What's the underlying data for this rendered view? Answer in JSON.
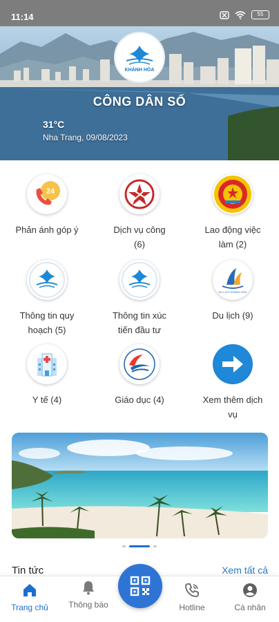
{
  "status_bar": {
    "time": "11:14",
    "battery": "55"
  },
  "hero": {
    "logo_text": "KHÁNH HÒA",
    "title": "CÔNG DÂN SỐ",
    "temperature": "31°C",
    "location_date": "Nha Trang, 09/08/2023"
  },
  "services": [
    {
      "line1": "Phản ánh góp ý",
      "line2": ""
    },
    {
      "line1": "Dịch vụ công",
      "line2": "(6)"
    },
    {
      "line1": "Lao động việc",
      "line2": "làm (2)"
    },
    {
      "line1": "Thông tin quy",
      "line2": "hoạch (5)"
    },
    {
      "line1": "Thông tin xúc",
      "line2": "tiến đầu tư"
    },
    {
      "line1": "Du lịch (9)",
      "line2": ""
    },
    {
      "line1": "Y tế (4)",
      "line2": ""
    },
    {
      "line1": "Giáo dục (4)",
      "line2": ""
    },
    {
      "line1": "Xem thêm dịch",
      "line2": "vụ"
    }
  ],
  "icons": {
    "feedback": "24",
    "tourism": "DU LỊCH KHÁNH HÒA"
  },
  "carousel": {
    "slide_count": 3,
    "active_index": 1
  },
  "news": {
    "title": "Tin tức",
    "see_all": "Xem tất cả"
  },
  "bottom_nav": {
    "home": "Trang chủ",
    "notifications": "Thông báo",
    "hotline": "Hotline",
    "profile": "Cá nhân"
  },
  "colors": {
    "primary": "#1b6fd0",
    "qr_button": "#2d74d5"
  }
}
